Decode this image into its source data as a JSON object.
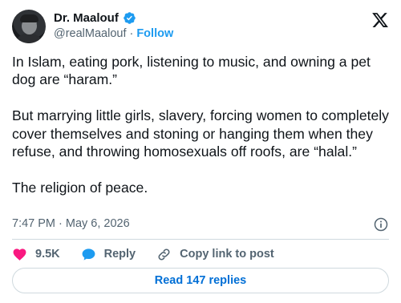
{
  "author": {
    "name": "Dr. Maalouf",
    "handle": "@realMaalouf",
    "separator": "·",
    "follow_label": "Follow"
  },
  "tweet": {
    "text": "In Islam, eating pork, listening to music, and owning a pet dog are “haram.”\n\nBut marrying little girls, slavery, forcing women to completely cover themselves and stoning or hanging them when they refuse, and throwing homosexuals off roofs, are “halal.”\n\nThe religion of peace.",
    "timestamp": "7:47 PM · May 6, 2026"
  },
  "actions": {
    "like_count": "9.5K",
    "reply_label": "Reply",
    "copy_label": "Copy link to post"
  },
  "replies_button": "Read 147 replies",
  "colors": {
    "accent": "#1d9bf0",
    "like": "#f91880",
    "muted": "#536471",
    "text": "#0f1419",
    "border": "#cfd9de",
    "replies_link": "#006fd6"
  },
  "icons": {
    "verified": "verified-badge-icon",
    "logo": "x-logo-icon",
    "info": "info-icon",
    "like": "heart-icon",
    "reply": "speech-bubble-icon",
    "copy": "link-icon"
  }
}
